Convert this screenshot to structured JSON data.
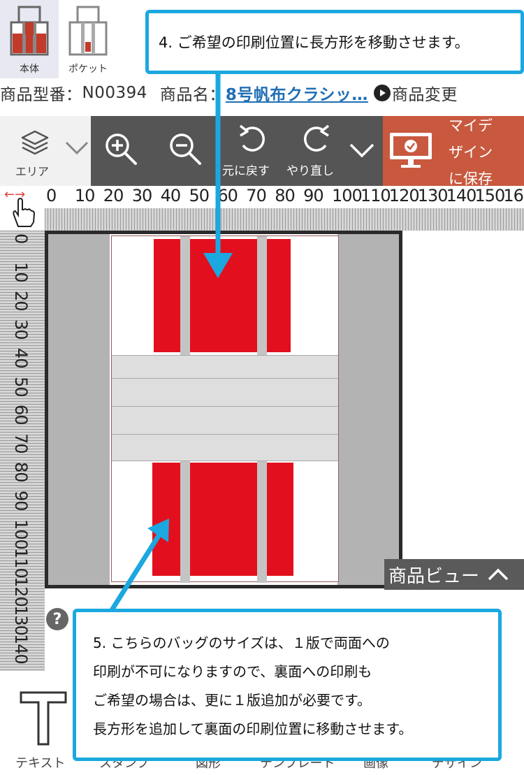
{
  "faces": [
    {
      "label": "本体",
      "active": true
    },
    {
      "label": "ポケット",
      "active": false
    }
  ],
  "product": {
    "number_label": "商品型番：",
    "number": "N00394",
    "name_label": "商品名：",
    "name": "8号帆布クラシッ…",
    "change_label": "商品変更"
  },
  "toolbar": {
    "area_label": "エリア",
    "undo_label": "元に戻す",
    "redo_label": "やり直し",
    "save_line1": "マイデ",
    "save_line2": "ザイン",
    "save_line3": "に保存"
  },
  "ruler_h": [
    "0",
    "10",
    "20",
    "30",
    "40",
    "50",
    "60",
    "70",
    "80",
    "90",
    "100",
    "110",
    "120",
    "130",
    "140",
    "150",
    "16"
  ],
  "ruler_v": [
    "0",
    "10",
    "20",
    "30",
    "40",
    "50",
    "60",
    "70",
    "80",
    "90",
    "100",
    "110",
    "120",
    "130",
    "140"
  ],
  "product_view_label": "商品ビュー",
  "help_label": "?",
  "bottom_tools": [
    "テキスト",
    "スタンプ",
    "図形",
    "テンプレート",
    "画像",
    "デザイン"
  ],
  "callouts": {
    "step4": "4. ご希望の印刷位置に長方形を移動させます。",
    "step5": [
      "5. こちらのバッグのサイズは、１版で両面への",
      "印刷が不可になりますので、裏面への印刷も",
      "ご希望の場合は、更に１版追加が必要です。",
      "長方形を追加して裏面の印刷位置に移動させます。"
    ]
  },
  "colors": {
    "print_area": "#e2101e",
    "accent": "#1ba8e0",
    "save_button": "#c8593f",
    "toolbar": "#555555",
    "link": "#1f6fb5"
  }
}
